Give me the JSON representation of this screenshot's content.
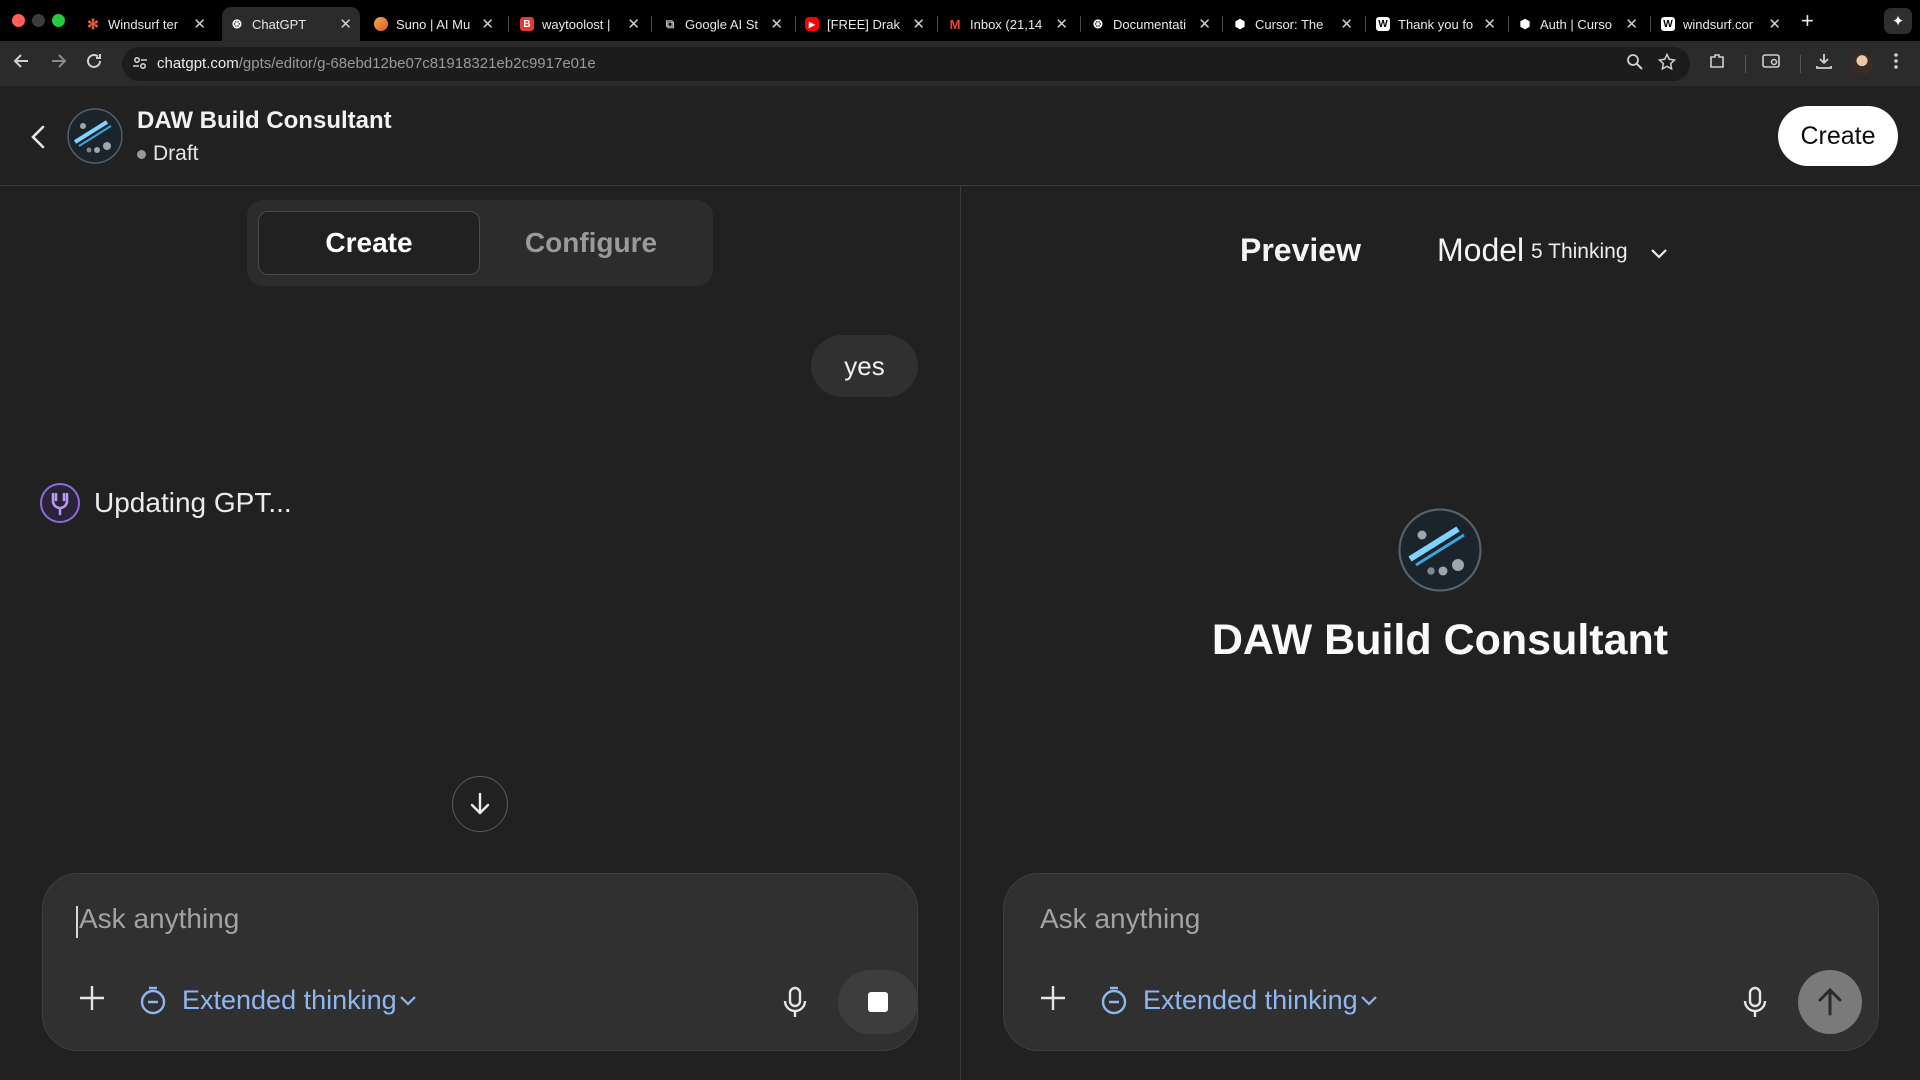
{
  "browser": {
    "tabs": [
      {
        "title": "Windsurf ter",
        "favicon": "windsurf-burst-icon",
        "color": "#e8603c"
      },
      {
        "title": "ChatGPT",
        "favicon": "openai-icon",
        "color": "#ffffff",
        "active": true
      },
      {
        "title": "Suno | AI Mu",
        "favicon": "suno-icon",
        "color": "#f08a3c"
      },
      {
        "title": "waytoolost |",
        "favicon": "b-icon",
        "color": "#e53935"
      },
      {
        "title": "Google AI St",
        "favicon": "google-ai-icon",
        "color": "#bbbbbb"
      },
      {
        "title": "[FREE] Drak",
        "favicon": "youtube-icon",
        "color": "#ff0000"
      },
      {
        "title": "Inbox (21,14",
        "favicon": "gmail-icon",
        "color": "#ea4335"
      },
      {
        "title": "Documentati",
        "favicon": "openai-icon",
        "color": "#ffffff"
      },
      {
        "title": "Cursor: The",
        "favicon": "cursor-icon",
        "color": "#ffffff"
      },
      {
        "title": "Thank you fo",
        "favicon": "windsurf-w-icon",
        "color": "#ffffff"
      },
      {
        "title": "Auth | Curso",
        "favicon": "cursor-icon",
        "color": "#ffffff"
      },
      {
        "title": "windsurf.cor",
        "favicon": "windsurf-w-icon",
        "color": "#ffffff"
      }
    ],
    "url_domain": "chatgpt.com",
    "url_path": "/gpts/editor/g-68ebd12be07c81918321eb2c9917e01e"
  },
  "header": {
    "title": "DAW Build Consultant",
    "status": "Draft",
    "create_label": "Create"
  },
  "left": {
    "tabs": {
      "create": "Create",
      "configure": "Configure"
    },
    "user_message": "yes",
    "updating_text": "Updating GPT...",
    "composer": {
      "placeholder": "Ask anything",
      "thinking_label": "Extended thinking"
    }
  },
  "right": {
    "preview_label": "Preview",
    "model_label": "Model",
    "model_value": "5 Thinking",
    "gpt_name": "DAW Build Consultant",
    "composer": {
      "placeholder": "Ask anything",
      "thinking_label": "Extended thinking"
    }
  },
  "colors": {
    "background": "#212121",
    "composer": "#303030",
    "thinking_accent": "#8fb6f0",
    "updating_accent": "#8e6ad8"
  }
}
